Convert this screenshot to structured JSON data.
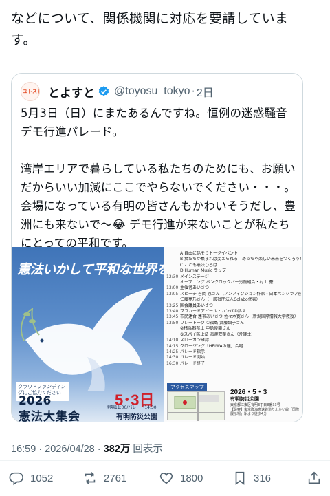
{
  "tweet": {
    "text": "などについて、関係機関に対応を要請していま\nす。"
  },
  "quote": {
    "avatar_text": "ユトスト",
    "name": "とよすと",
    "handle": "@toyosu_tokyo",
    "time": "2日",
    "body": "5月3日（日）にまたあるんですね。恒例の迷惑騒音デモ行進パレード。\n\n湾岸エリアで暮らしている私たちのためにも、お願いだからいい加減にここでやらないでください・・・。会場になっている有明の皆さんもかわいそうだし、豊洲にも来ないで〜😂 デモ行進が来ないことが私たちにとっての平和です。",
    "poster": {
      "title": "憲法いかして平和な世界を！",
      "logo_text": "クラウドファンディングにご協力ください",
      "year": "2026",
      "event": "憲法大集会",
      "date": "5･3日",
      "time": "開場11:00/パレード14:30",
      "venue": "有明防災公園"
    },
    "schedule": [
      {
        "t": "",
        "text": "A 自由に話そうトークイベント"
      },
      {
        "t": "",
        "text": "B 女たちが集まれば変えられる！めっちゃ楽しい未来をつくろう！"
      },
      {
        "t": "",
        "text": "C こども憲法ひろば"
      },
      {
        "t": "",
        "text": "D Human Music ラップ"
      },
      {
        "t": "12:30",
        "text": "メインステージ"
      },
      {
        "t": "",
        "text": "オープニング パンクロックバー労働組合・村上 豪"
      },
      {
        "t": "13:00",
        "text": "主催者あいさつ"
      },
      {
        "t": "13:05",
        "text": "スピーチ 吉岡 忍さん（ノンフィクション作家・日本ペンクラブ前会長）"
      },
      {
        "t": "",
        "text": "仁藤夢乃さん（一般社団法人Colabo代表）"
      },
      {
        "t": "13:25",
        "text": "国会議員あいさつ"
      },
      {
        "t": "13:40",
        "text": "プラカードアピール・カンパの訴え"
      },
      {
        "t": "13:45",
        "text": "市民連合 連帯あいさつ 佐々木寛さん（新潟国際情報大学教授）"
      },
      {
        "t": "13:50",
        "text": "リレートーク ①福島 武藤類子さん"
      },
      {
        "t": "",
        "text": "②核兵器禁止 中島俊範さん"
      },
      {
        "t": "",
        "text": "③スパイ防止法 海渡双葉さん（弁護士）"
      },
      {
        "t": "14:10",
        "text": "スローガン確認"
      },
      {
        "t": "14:15",
        "text": "クロージング「HEIWAの鐘」合唱"
      },
      {
        "t": "14:25",
        "text": "パレード指示"
      },
      {
        "t": "14:30",
        "text": "パレード開始"
      },
      {
        "t": "16:30",
        "text": "パレード終了"
      }
    ],
    "map": {
      "title": "アクセスマップ",
      "date": "2026・5・3",
      "venue": "有明防災公園",
      "address": "東京都江東区有明3丁目8番33号",
      "note": "【最寄】東京臨海高速鉄道りんかい線「国際展示場」駅より徒歩4分"
    }
  },
  "meta": {
    "time": "16:59 · 2026/04/28 · ",
    "views": "382万",
    "views_label": "回表示"
  },
  "actions": {
    "replies": "1052",
    "reposts": "2761",
    "likes": "1800",
    "bookmarks": "316"
  },
  "colors": {
    "text": "#0f1419",
    "secondary": "#536471",
    "border": "#cfd9de",
    "verified": "#1d9bf0",
    "poster_blue": "#3f74b8",
    "poster_red": "#d0202a"
  }
}
